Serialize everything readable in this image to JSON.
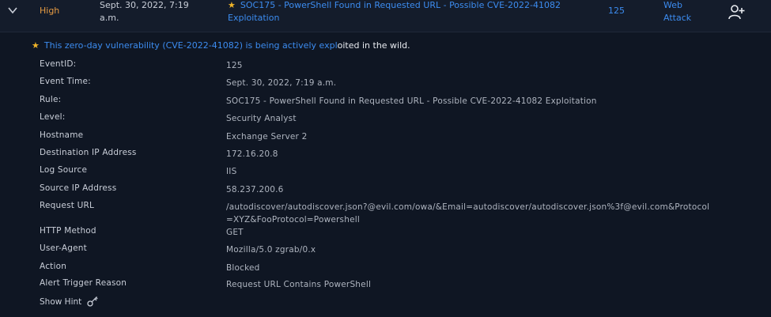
{
  "alert": {
    "severity": "High",
    "date_time": "Sept. 30, 2022, 7:19 a.m.",
    "rule": "SOC175 - PowerShell Found in Requested URL - Possible CVE-2022-41082 Exploitation",
    "event_id": "125",
    "type": "Web Attack",
    "icons": {
      "expand": "chevron-down-icon",
      "assign": "add-user-icon",
      "star": "star-icon"
    },
    "colors": {
      "severity": "#e59b43",
      "link": "#3c8cf0",
      "star": "#f0b429"
    }
  },
  "note": {
    "link_text": "This zero-day vulnerability (CVE-2022-41082) is being actively expl",
    "rest_text": "oited in the wild."
  },
  "details": [
    {
      "label": "EventID:",
      "value": "125"
    },
    {
      "label": "Event Time:",
      "value": "Sept. 30, 2022, 7:19 a.m."
    },
    {
      "label": "Rule:",
      "value": "SOC175 - PowerShell Found in Requested URL - Possible CVE-2022-41082 Exploitation"
    },
    {
      "label": "Level:",
      "value": "Security Analyst"
    },
    {
      "label": "Hostname",
      "value": "Exchange Server 2"
    },
    {
      "label": "Destination IP Address",
      "value": "172.16.20.8"
    },
    {
      "label": "Log Source",
      "value": "IIS"
    },
    {
      "label": "Source IP Address",
      "value": "58.237.200.6"
    },
    {
      "label": "Request URL",
      "value": "/autodiscover/autodiscover.json?@evil.com/owa/&Email=autodiscover/autodiscover.json%3f@evil.com&Protocol=XYZ&FooProtocol=Powershell"
    },
    {
      "label": "HTTP Method",
      "value": "GET"
    },
    {
      "label": "User-Agent",
      "value": "Mozilla/5.0 zgrab/0.x"
    },
    {
      "label": "Action",
      "value": "Blocked"
    },
    {
      "label": "Alert Trigger Reason",
      "value": "Request URL Contains PowerShell"
    }
  ],
  "hint": {
    "label": "Show Hint",
    "icon": "key-icon"
  }
}
